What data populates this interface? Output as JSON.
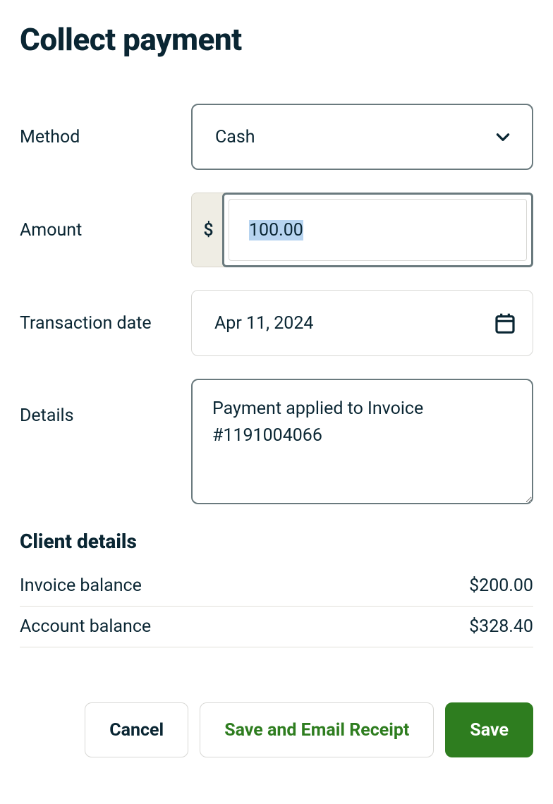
{
  "title": "Collect payment",
  "form": {
    "method": {
      "label": "Method",
      "value": "Cash"
    },
    "amount": {
      "label": "Amount",
      "currency_symbol": "$",
      "value": "100.00"
    },
    "transaction_date": {
      "label": "Transaction date",
      "value": "Apr 11, 2024"
    },
    "details": {
      "label": "Details",
      "value": "Payment applied to Invoice #1191004066"
    }
  },
  "client_details": {
    "title": "Client details",
    "invoice_balance": {
      "label": "Invoice balance",
      "value": "$200.00"
    },
    "account_balance": {
      "label": "Account balance",
      "value": "$328.40"
    }
  },
  "buttons": {
    "cancel": "Cancel",
    "save_email": "Save and Email Receipt",
    "save": "Save"
  }
}
